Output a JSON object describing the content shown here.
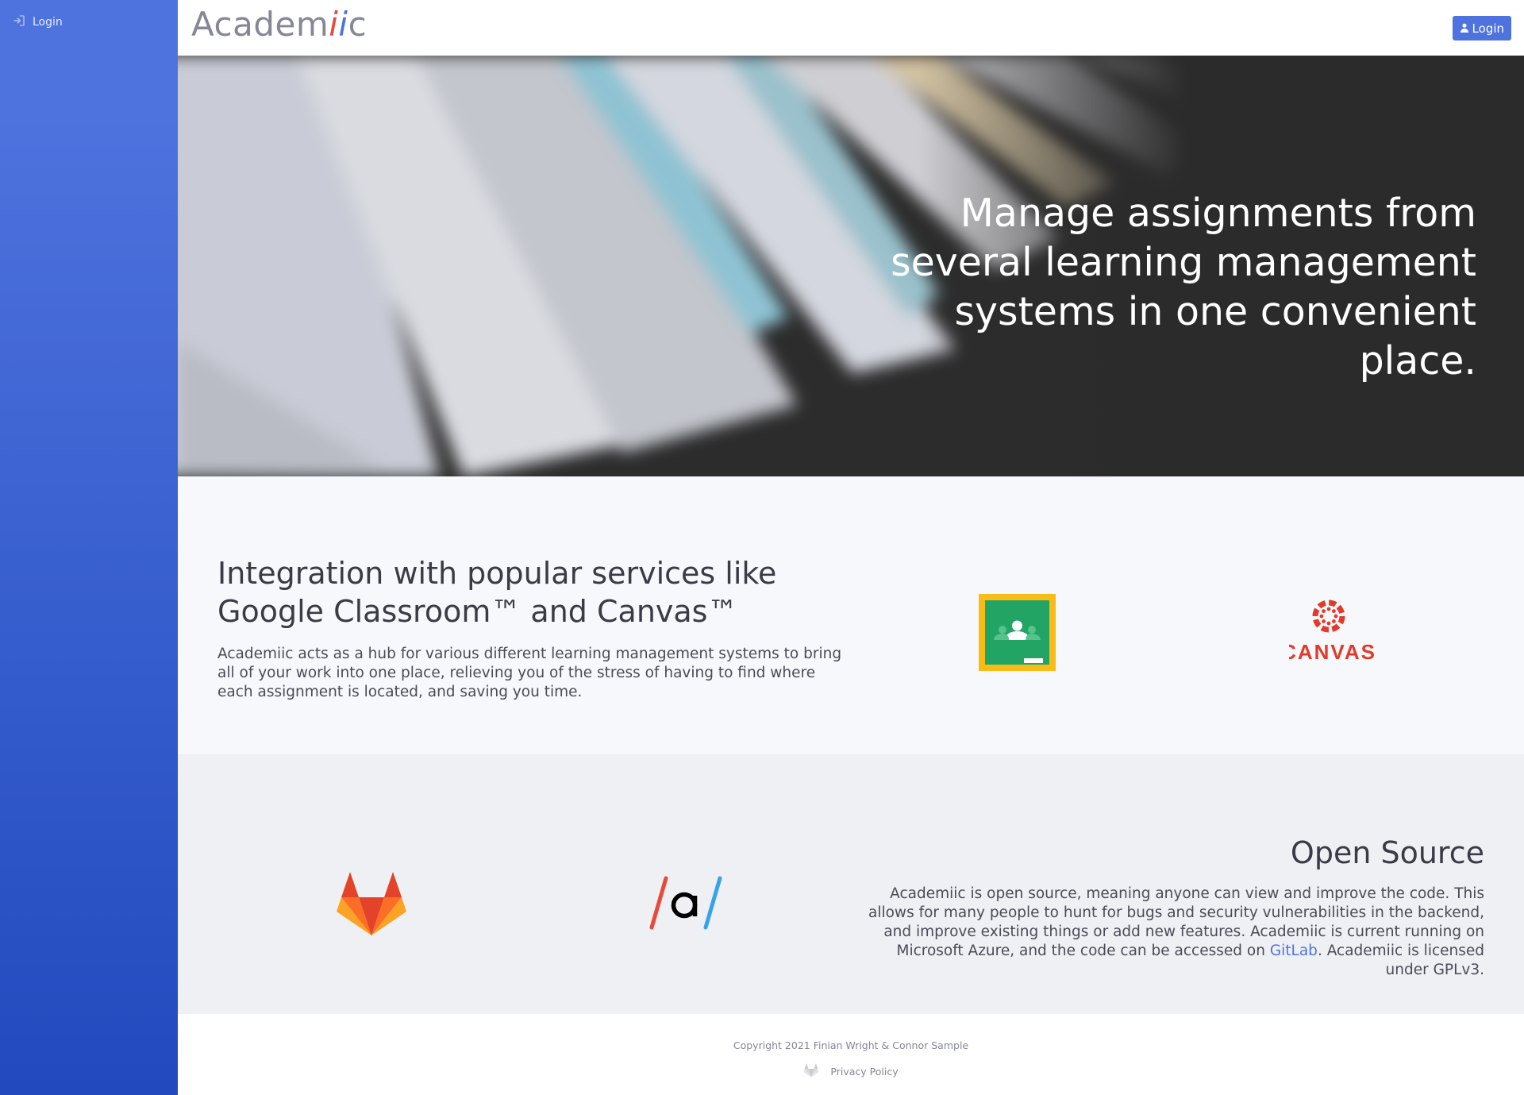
{
  "sidebar": {
    "items": [
      {
        "label": "Login",
        "icon": "sign-in-icon"
      }
    ],
    "gradient": [
      "#4e73df",
      "#224abe"
    ]
  },
  "topbar": {
    "brand_prefix": "Academ",
    "brand_i1": "i",
    "brand_i2": "i",
    "brand_suffix": "c",
    "login_label": "Login",
    "login_icon": "user-icon"
  },
  "hero": {
    "headline": "Manage assignments from several learning management systems in one convenient place."
  },
  "integration": {
    "title": "Integration with popular services like Google Classroom™ and Canvas™",
    "body": "Academiic acts as a hub for various different learning management systems to bring all of your work into one place, relieving you of the stress of having to find where each assignment is located, and saving you time.",
    "logos": [
      "google-classroom-logo",
      "canvas-logo"
    ],
    "canvas_wordmark": "CANVAS"
  },
  "opensource": {
    "title": "Open Source",
    "body_before_link": "Academiic is open source, meaning anyone can view and improve the code. This allows for many people to hunt for bugs and security vulnerabilities in the backend, and improve existing things or add new features. Academiic is current running on Microsoft Azure, and the code can be accessed on ",
    "link_label": "GitLab",
    "body_after_link": ". Academiic is licensed under GPLv3.",
    "logos": [
      "gitlab-logo",
      "academiic-a-logo"
    ]
  },
  "footer": {
    "copyright": "Copyright 2021 Finian Wright & Connor Sample",
    "privacy_label": "Privacy Policy",
    "gitlab_icon": "gitlab-icon"
  },
  "colors": {
    "primary": "#4e73df",
    "accent_red": "#e74a3b",
    "text": "#3a3b45",
    "muted": "#858796"
  }
}
